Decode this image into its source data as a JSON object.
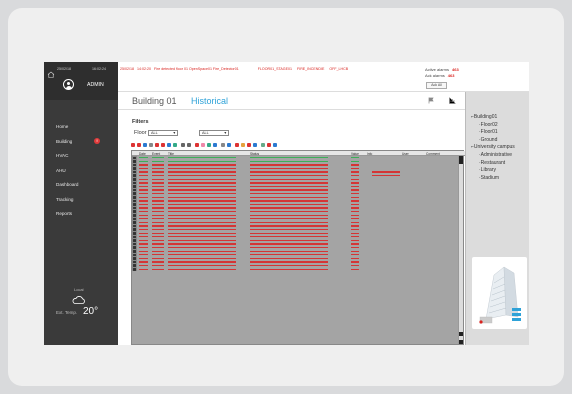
{
  "sidebar": {
    "date": "25/02/18",
    "time": "16:02:24",
    "user": "ADMIN",
    "nav": [
      {
        "label": "Home"
      },
      {
        "label": "Building",
        "alert": "!"
      },
      {
        "label": "HVAC"
      },
      {
        "label": "AHU"
      },
      {
        "label": "Dashboard"
      },
      {
        "label": "Tracking"
      },
      {
        "label": "Reports"
      }
    ],
    "local_label": "Local",
    "temp_label": "Ext. Temp.",
    "temp_value": "20°"
  },
  "banner": {
    "alarm_date": "25/02/18",
    "alarm_time": "14:02:20",
    "alarm_text": "Fire detected floor 01 OpenSpace01 Fire_Detector01",
    "alarm_loc": "FLOOR01_STAGE01",
    "alarm_code": "FIRE_INCENDIE",
    "alarm_tag": "OFF_LHCB",
    "active_label": "Active alarms",
    "active_count": "463",
    "ack_label": "Ack alarms",
    "ack_count": "463",
    "ack_all": "Ack All"
  },
  "title": {
    "building": "Building 01",
    "historical": "Historical"
  },
  "filters": {
    "heading": "Filters",
    "floor_label": "Floor",
    "floor_value": "ALL",
    "type_value": "ALL"
  },
  "grid": {
    "headers": [
      "Date",
      "Event",
      "Title",
      "Status",
      "Value",
      "Info",
      "User",
      "Comment"
    ]
  },
  "tree": {
    "items": [
      {
        "label": "Building01",
        "level": 0
      },
      {
        "label": "Floor02",
        "level": 1
      },
      {
        "label": "Floor01",
        "level": 1
      },
      {
        "label": "Ground",
        "level": 1
      },
      {
        "label": "University campus",
        "level": 0
      },
      {
        "label": "Administrative",
        "level": 1
      },
      {
        "label": "Restaurant",
        "level": 1
      },
      {
        "label": "Library",
        "level": 1
      },
      {
        "label": "Stadium",
        "level": 1
      }
    ]
  },
  "colors": {
    "accent": "#2ea2d8",
    "alarm": "#d9231f",
    "sidebar": "#3a3a3a"
  }
}
